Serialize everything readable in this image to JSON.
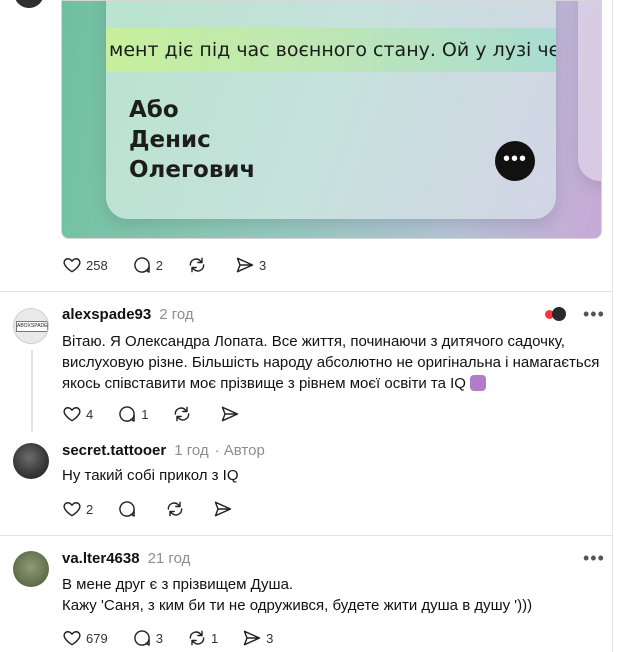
{
  "post": {
    "media": {
      "scroll_text": "мент діє під час воєнного стану. Ой у лузі черво",
      "name_lines": [
        "Або",
        "Денис",
        "Олегович"
      ],
      "more_glyph": "•••"
    },
    "actions": {
      "likes": "258",
      "replies": "2",
      "reposts": "",
      "shares": "3"
    }
  },
  "comments": [
    {
      "username": "alexspade93",
      "time": "2 год",
      "author_tag": "",
      "text_lines": [
        "Вітаю. Я Олександра Лопата. Все життя, починаючи з дитячого садочку,",
        "вислуховую різне. Більшість народу абсолютно не оригінальна і намагається",
        "якось співставити моє прізвище з рівнем моєї освіти та IQ"
      ],
      "avatar_text": "ABOXSPADE",
      "actions": {
        "likes": "4",
        "replies": "1",
        "reposts": "",
        "shares": ""
      }
    },
    {
      "username": "secret.tattooer",
      "time": "1 год",
      "author_tag": "· Автор",
      "text_lines": [
        "Ну такий собі прикол з IQ"
      ],
      "actions": {
        "likes": "2",
        "replies": "",
        "reposts": "",
        "shares": ""
      }
    },
    {
      "username": "va.lter4638",
      "time": "21 год",
      "author_tag": "",
      "text_lines": [
        "В мене друг є з прізвищем Душа.",
        "Кажу 'Саня, з ким би ти не одружився, будете жити душа в душу ')))"
      ],
      "actions": {
        "likes": "679",
        "replies": "3",
        "reposts": "1",
        "shares": "3"
      }
    }
  ],
  "icons": {
    "like": "heart-icon",
    "reply": "comment-icon",
    "repost": "repost-icon",
    "share": "share-icon",
    "more": "more-icon",
    "liked": "liked-by-author-icon"
  },
  "colors": {
    "media_start": "#6fbf9f",
    "media_end": "#c8a8d6",
    "strip": "#c8ef9d",
    "muted": "#8e8e8e"
  }
}
